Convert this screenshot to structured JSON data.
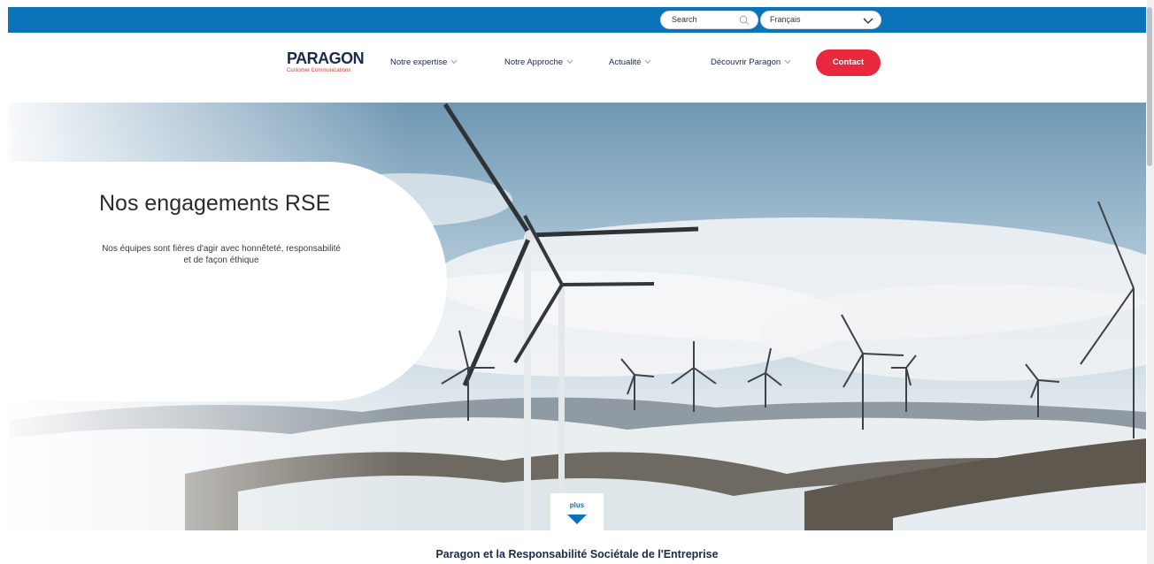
{
  "header": {
    "search_placeholder": "Search",
    "language": "Français",
    "logo_brand": "PARAGON",
    "logo_sub": "Customer Communications"
  },
  "nav": {
    "items": [
      {
        "label": "Notre expertise"
      },
      {
        "label": "Notre Approche"
      },
      {
        "label": "Actualité"
      },
      {
        "label": "Découvrir Paragon"
      }
    ],
    "contact_label": "Contact"
  },
  "hero": {
    "title": "Nos engagements RSE",
    "text": "Nos équipes sont fières d'agir avec honnêteté, responsabilité et de façon éthique",
    "more_label": "plus"
  },
  "section": {
    "title": "Paragon et la Responsabilité Sociétale de l'Entreprise"
  },
  "colors": {
    "topbar": "#0a74b8",
    "contact": "#e8283d",
    "navy": "#1a2a4a"
  }
}
